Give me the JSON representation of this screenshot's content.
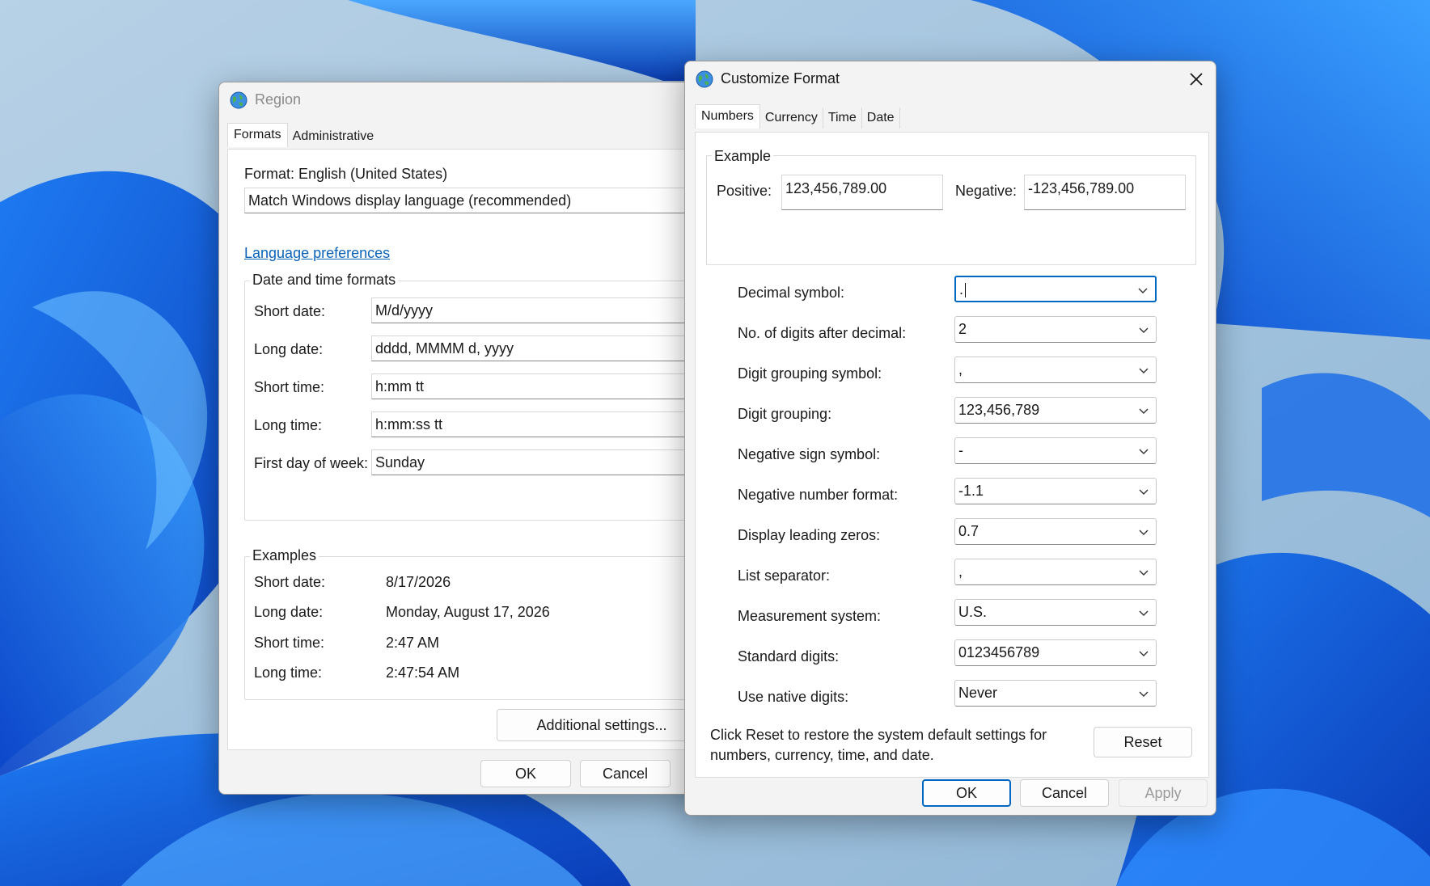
{
  "region_dialog": {
    "title": "Region",
    "tabs": [
      {
        "label": "Formats",
        "active": true
      },
      {
        "label": "Administrative",
        "active": false
      }
    ],
    "format_label": "Format: English (United States)",
    "format_value": "Match Windows display language (recommended)",
    "language_link": "Language preferences",
    "date_time_group": {
      "title": "Date and time formats",
      "rows": [
        {
          "label": "Short date:",
          "value": "M/d/yyyy"
        },
        {
          "label": "Long date:",
          "value": "dddd, MMMM d, yyyy"
        },
        {
          "label": "Short time:",
          "value": "h:mm tt"
        },
        {
          "label": "Long time:",
          "value": "h:mm:ss tt"
        },
        {
          "label": "First day of week:",
          "value": "Sunday"
        }
      ]
    },
    "examples_group": {
      "title": "Examples",
      "rows": [
        {
          "label": "Short date:",
          "value": "8/17/2026"
        },
        {
          "label": "Long date:",
          "value": "Monday, August 17, 2026"
        },
        {
          "label": "Short time:",
          "value": "2:47 AM"
        },
        {
          "label": "Long time:",
          "value": "2:47:54 AM"
        }
      ]
    },
    "additional_settings": "Additional settings...",
    "ok": "OK",
    "cancel": "Cancel"
  },
  "customize_dialog": {
    "title": "Customize Format",
    "tabs": [
      {
        "label": "Numbers",
        "active": true
      },
      {
        "label": "Currency",
        "active": false
      },
      {
        "label": "Time",
        "active": false
      },
      {
        "label": "Date",
        "active": false
      }
    ],
    "example": {
      "title": "Example",
      "positive_label": "Positive:",
      "positive_value": "123,456,789.00",
      "negative_label": "Negative:",
      "negative_value": "-123,456,789.00"
    },
    "settings": [
      {
        "label": "Decimal symbol:",
        "value": "."
      },
      {
        "label": "No. of digits after decimal:",
        "value": "2"
      },
      {
        "label": "Digit grouping symbol:",
        "value": ","
      },
      {
        "label": "Digit grouping:",
        "value": "123,456,789"
      },
      {
        "label": "Negative sign symbol:",
        "value": "-"
      },
      {
        "label": "Negative number format:",
        "value": "-1.1"
      },
      {
        "label": "Display leading zeros:",
        "value": "0.7"
      },
      {
        "label": "List separator:",
        "value": ","
      },
      {
        "label": "Measurement system:",
        "value": "U.S."
      },
      {
        "label": "Standard digits:",
        "value": "0123456789"
      },
      {
        "label": "Use native digits:",
        "value": "Never"
      }
    ],
    "reset_note": "Click Reset to restore the system default settings for numbers, currency, time, and date.",
    "reset": "Reset",
    "ok": "OK",
    "cancel": "Cancel",
    "apply": "Apply"
  },
  "colors": {
    "accent": "#0067c0",
    "link": "#0b63b8",
    "wallpaper_blue": "#0a4fd6"
  }
}
